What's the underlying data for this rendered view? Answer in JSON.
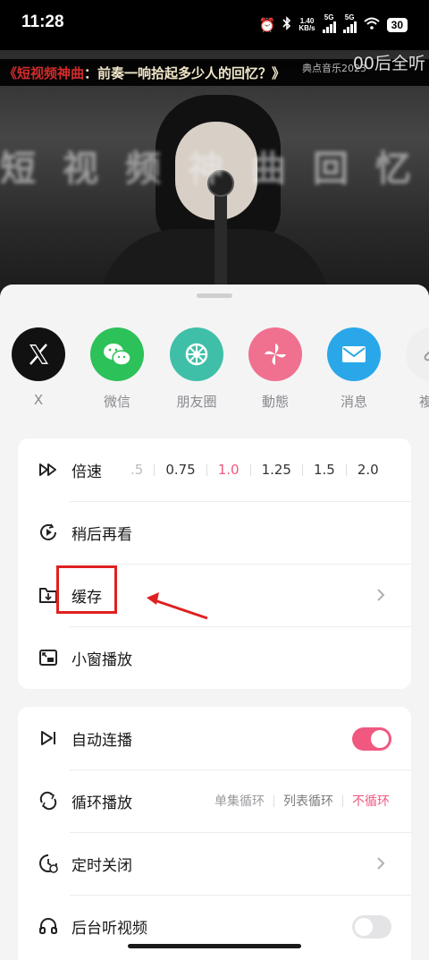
{
  "status_bar": {
    "time": "11:28",
    "net_speed_value": "1.40",
    "net_speed_unit": "KB/s",
    "network_label_1": "5G",
    "network_label_2": "5G",
    "battery": "30",
    "icons": [
      "alarm-icon",
      "bluetooth-icon",
      "signal-icon",
      "wifi-icon"
    ]
  },
  "video": {
    "title_highlight": "《短视频神曲",
    "title_rest": "：前奏一响拾起多少人的回忆？》",
    "watermark_small": "典点音乐2023",
    "watermark": "00后全听"
  },
  "share": {
    "items": [
      {
        "label": "X",
        "icon": "x-logo-icon",
        "color": "#111111"
      },
      {
        "label": "微信",
        "icon": "wechat-icon",
        "color": "#2dc159"
      },
      {
        "label": "朋友圈",
        "icon": "moments-icon",
        "color": "#3fbfa7"
      },
      {
        "label": "動態",
        "icon": "pinwheel-icon",
        "color": "#f0708f"
      },
      {
        "label": "消息",
        "icon": "mail-icon",
        "color": "#2aa7e8"
      },
      {
        "label": "複制",
        "icon": "link-icon",
        "color": "#efefef"
      }
    ]
  },
  "menu1": {
    "speed": {
      "label": "倍速",
      "icon": "fast-forward-icon",
      "options": [
        ".5",
        "0.75",
        "1.0",
        "1.25",
        "1.5",
        "2.0"
      ],
      "selected": "1.0"
    },
    "watch_later": {
      "label": "稍后再看",
      "icon": "play-later-icon"
    },
    "cache": {
      "label": "缓存",
      "icon": "download-folder-icon"
    },
    "mini_window": {
      "label": "小窗播放",
      "icon": "picture-in-picture-icon"
    }
  },
  "menu2": {
    "autoplay": {
      "label": "自动连播",
      "icon": "skip-next-icon",
      "enabled": true
    },
    "loop": {
      "label": "循环播放",
      "icon": "loop-icon",
      "options": [
        "单集循环",
        "列表循环",
        "不循环"
      ],
      "selected": "不循环"
    },
    "timer": {
      "label": "定时关闭",
      "icon": "timer-icon"
    },
    "background": {
      "label": "后台听视频",
      "icon": "headphones-icon",
      "enabled": false
    }
  },
  "annotation": {
    "highlight_color": "#e02020"
  }
}
